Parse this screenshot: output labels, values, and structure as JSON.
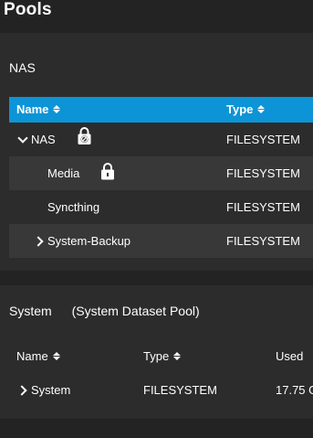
{
  "page": {
    "title": "Pools"
  },
  "nas_pool": {
    "name": "NAS",
    "columns": {
      "name": "Name",
      "type": "Type"
    },
    "rows": [
      {
        "name": "NAS",
        "type": "FILESYSTEM",
        "expander": "chevron-down",
        "lock": "lock-disabled-icon"
      },
      {
        "name": "Media",
        "type": "FILESYSTEM",
        "lock": "lock-icon"
      },
      {
        "name": "Syncthing",
        "type": "FILESYSTEM"
      },
      {
        "name": "System-Backup",
        "type": "FILESYSTEM",
        "expander": "chevron-right"
      }
    ]
  },
  "system_pool": {
    "name": "System",
    "subtitle": "(System Dataset Pool)",
    "columns": {
      "name": "Name",
      "type": "Type",
      "used": "Used"
    },
    "rows": [
      {
        "name": "System",
        "type": "FILESYSTEM",
        "used": "17.75 G",
        "expander": "chevron-right"
      }
    ]
  },
  "colors": {
    "header_blue": "#0c94d6",
    "background": "#232323",
    "card": "#2c2c2c",
    "row_alt": "#383838"
  }
}
